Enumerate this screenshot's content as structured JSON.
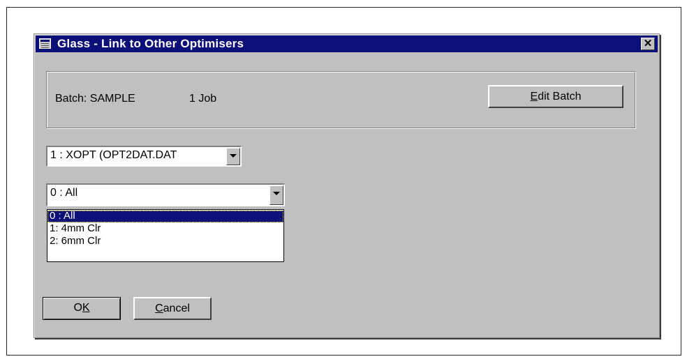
{
  "dialog": {
    "title": "Glass - Link to Other Optimisers",
    "close_glyph": "✕"
  },
  "batch": {
    "label": "Batch: SAMPLE",
    "job_count": "1 Job",
    "edit_button_prefix": "E",
    "edit_button_rest": "dit Batch"
  },
  "optimiser_combo": {
    "value": "1 : XOPT (OPT2DAT.DAT"
  },
  "group_combo": {
    "value": "0  : All",
    "options": [
      "0  : All",
      "1: 4mm Clr",
      "2: 6mm Clr"
    ],
    "selected_index": 0
  },
  "buttons": {
    "ok_prefix": "O",
    "ok_underlined": "K",
    "cancel_underlined": "C",
    "cancel_rest": "ancel"
  },
  "colors": {
    "titlebar": "#0b0f77",
    "face": "#c0c0c0"
  }
}
